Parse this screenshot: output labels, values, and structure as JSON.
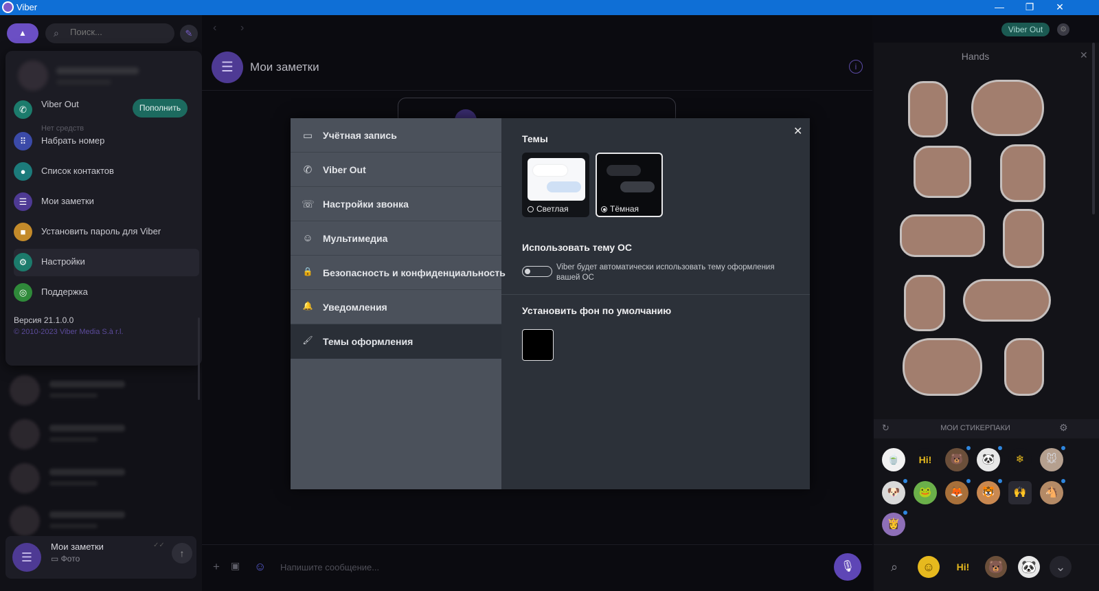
{
  "window": {
    "title": "Viber",
    "min": "—",
    "max": "❐",
    "close": "✕"
  },
  "left": {
    "compose_icon": "▲",
    "search_placeholder": "Поиск...",
    "search_icon": "⌕",
    "newchat_icon": "✎",
    "menu": {
      "viber_out_label": "Viber Out",
      "viber_out_sub": "Нет средств",
      "topup": "Пополнить",
      "items": [
        {
          "label": "Viber Out",
          "icon": "phone-icon",
          "color": "#1c7b6c"
        },
        {
          "label": "Набрать номер",
          "icon": "dialpad-icon",
          "color": "#3b4aa8"
        },
        {
          "label": "Список контактов",
          "icon": "contacts-icon",
          "color": "#1c7b7b"
        },
        {
          "label": "Мои заметки",
          "icon": "notes-icon",
          "color": "#4e3a94"
        },
        {
          "label": "Установить пароль для Viber",
          "icon": "lock-icon",
          "color": "#c38a2a"
        },
        {
          "label": "Настройки",
          "icon": "gear-icon",
          "color": "#1c7b6c"
        },
        {
          "label": "Поддержка",
          "icon": "support-icon",
          "color": "#2f8a3a"
        }
      ],
      "version": "Версия 21.1.0.0",
      "copyright": "© 2010-2023 Viber Media S.à r.l."
    },
    "current_chat": {
      "name": "Мои заметки",
      "sub": "Фото",
      "status": "✓✓"
    }
  },
  "middle": {
    "title": "Мои заметки",
    "info_icon": "i",
    "composer_placeholder": "Напишите сообщение..."
  },
  "topright": {
    "viber_out_button": "Viber Out"
  },
  "stickers": {
    "title": "Hands",
    "packs_label": "МОИ СТИКЕРПАКИ",
    "pack_icons": [
      "🍵",
      "Hi!",
      "🐻",
      "🐼",
      "❄",
      "🐭",
      "🐶",
      "🐸",
      "🦊",
      "🐯",
      "🙌",
      "🐴",
      "👸"
    ],
    "bottom_icons": [
      "⌕",
      "☺",
      "Hi!",
      "🐻",
      "🐼",
      "⌄"
    ]
  },
  "settings": {
    "close": "✕",
    "menu": [
      {
        "label": "Учётная запись",
        "icon": "account-icon",
        "glyph": "▭"
      },
      {
        "label": "Viber Out",
        "icon": "call-icon",
        "glyph": "✆"
      },
      {
        "label": "Настройки звонка",
        "icon": "call-settings-icon",
        "glyph": "☏"
      },
      {
        "label": "Мультимедиа",
        "icon": "media-icon",
        "glyph": "☺"
      },
      {
        "label": "Безопасность и конфиденциальность",
        "icon": "lock-icon",
        "glyph": "🔒"
      },
      {
        "label": "Уведомления",
        "icon": "bell-icon",
        "glyph": "🔔"
      },
      {
        "label": "Темы оформления",
        "icon": "brush-icon",
        "glyph": "🖌"
      }
    ],
    "themes_title": "Темы",
    "theme_light": "Светлая",
    "theme_dark": "Тёмная",
    "selected_theme": "dark",
    "os_theme_title": "Использовать тему ОС",
    "os_theme_desc": "Viber будет автоматически использовать тему оформления вашей ОС",
    "os_theme_enabled": false,
    "default_bg_title": "Установить фон по умолчанию"
  }
}
